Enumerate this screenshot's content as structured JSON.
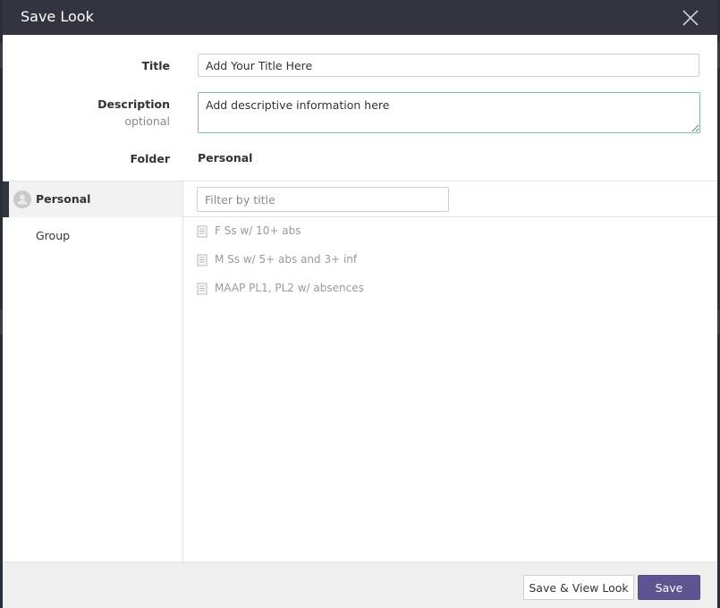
{
  "dialog": {
    "title": "Save Look"
  },
  "form": {
    "title_label": "Title",
    "title_value": "Add Your Title Here",
    "description_label": "Description",
    "description_sublabel": "optional",
    "description_value": "Add descriptive information here",
    "folder_label": "Folder",
    "folder_value": "Personal"
  },
  "sidebar": {
    "items": [
      {
        "label": "Personal",
        "active": true,
        "icon": "user-icon"
      },
      {
        "label": "Group",
        "active": false
      }
    ]
  },
  "filter": {
    "placeholder": "Filter by title"
  },
  "looks": [
    {
      "label": "F Ss w/ 10+ abs",
      "icon": "document-icon"
    },
    {
      "label": "M Ss w/ 5+ abs and 3+ inf",
      "icon": "document-icon"
    },
    {
      "label": "MAAP PL1, PL2 w/ absences",
      "icon": "document-icon"
    }
  ],
  "footer": {
    "save_view_label": "Save & View Look",
    "save_label": "Save"
  },
  "colors": {
    "header_bg": "#33343f",
    "primary_button": "#5d5491",
    "textarea_focus_border": "#7fbfb0"
  }
}
